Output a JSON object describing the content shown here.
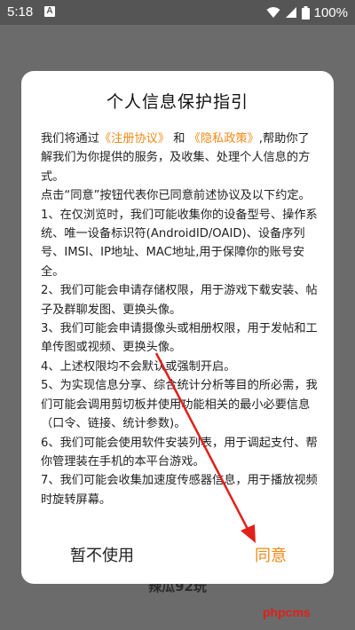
{
  "status_bar": {
    "time": "5:18",
    "notification_glyph": "A",
    "battery_percent": "100%",
    "icons": [
      "wifi-icon",
      "signal-icon",
      "battery-icon"
    ]
  },
  "dialog": {
    "title": "个人信息保护指引",
    "intro": {
      "part1": "我们将通过",
      "link_terms": "《注册协议》",
      "and": "和",
      "link_privacy": "《隐私政策》",
      "part2": ",帮助你了解我们为你提供的服务，及收集、处理个人信息的方式。"
    },
    "agree_note": "点击“同意”按钮代表你已同意前述协议及以下约定。",
    "items": [
      "1、在仅浏览时，我们可能收集你的设备型号、操作系统、唯一设备标识符(AndroidID/OAID)、设备序列号、IMSI、IP地址、MAC地址,用于保障你的账号安全。",
      "2、我们可能会申请存储权限，用于游戏下载安装、帖子及群聊发图、更换头像。",
      "3、我们可能会申请摄像头或相册权限，用于发帖和工单传图或视频、更换头像。",
      "4、上述权限均不会默认或强制开启。",
      "5、为实现信息分享、综合统计分析等目的所必需，我们可能会调用剪切板并使用功能相关的最小必要信息（口令、链接、统计参数)。",
      "6、我们可能会使用软件安装列表，用于调起支付、帮你管理装在手机的本平台游戏。",
      "7、我们可能会收集加速度传感器信息，用于播放视频时旋转屏幕。"
    ],
    "cancel_label": "暂不使用",
    "agree_label": "同意"
  },
  "background_text": "辣瓜92玩",
  "watermark": "phpcms",
  "colors": {
    "accent": "#f08a18",
    "annotation_arrow": "#e0201a",
    "overlay_bg": "#6b6b6b"
  }
}
